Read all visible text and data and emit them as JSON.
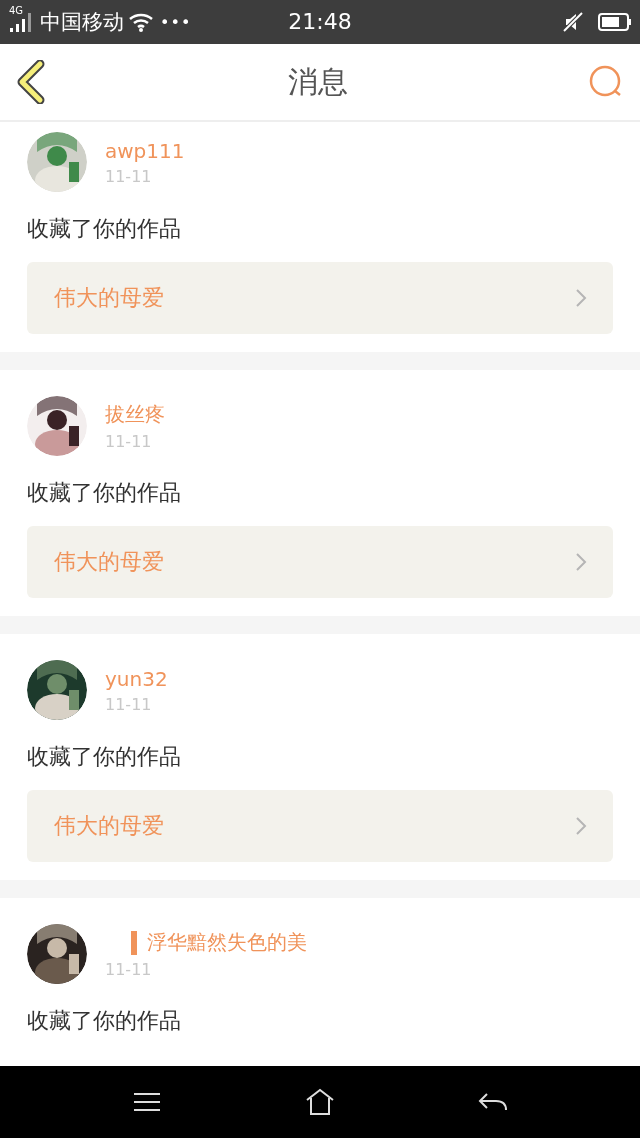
{
  "status_bar": {
    "network": "4G",
    "carrier": "中国移动",
    "more": "•••",
    "time": "21:48"
  },
  "header": {
    "title": "消息"
  },
  "messages": [
    {
      "user": "awp111",
      "name_mark": false,
      "date": "11-11",
      "action": "收藏了你的作品",
      "work": "伟大的母爱"
    },
    {
      "user": "拔丝疼",
      "name_mark": false,
      "date": "11-11",
      "action": "收藏了你的作品",
      "work": "伟大的母爱"
    },
    {
      "user": "yun32",
      "name_mark": false,
      "date": "11-11",
      "action": "收藏了你的作品",
      "work": "伟大的母爱"
    },
    {
      "user": "浮华黯然失色的美",
      "name_mark": true,
      "date": "11-11",
      "action": "收藏了你的作品"
    }
  ]
}
